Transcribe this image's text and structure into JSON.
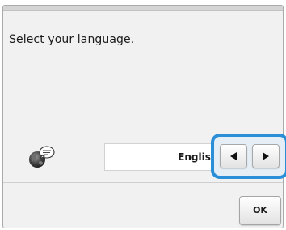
{
  "prompt": {
    "text": "Select your language."
  },
  "language": {
    "icon": "globe-speech-icon",
    "current": "Englisl"
  },
  "arrows": {
    "prev_icon": "left-triangle-icon",
    "next_icon": "right-triangle-icon",
    "highlight_color": "#2b8fd8"
  },
  "ok_button": {
    "label": "OK"
  }
}
